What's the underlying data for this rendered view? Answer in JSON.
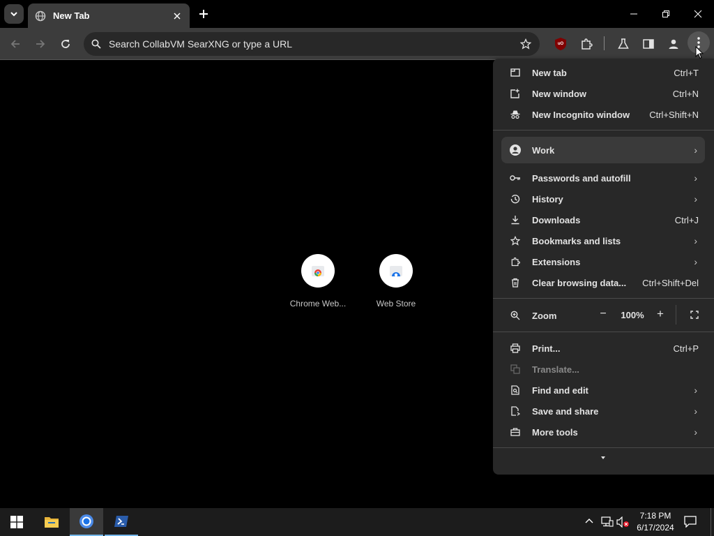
{
  "tab": {
    "title": "New Tab"
  },
  "omnibox": {
    "placeholder": "Search CollabVM SearXNG or type a URL"
  },
  "extensions": {
    "ublock_badge": "uO"
  },
  "shortcuts": [
    {
      "label": "Chrome Web..."
    },
    {
      "label": "Web Store"
    }
  ],
  "menu": {
    "new_tab": {
      "label": "New tab",
      "shortcut": "Ctrl+T"
    },
    "new_window": {
      "label": "New window",
      "shortcut": "Ctrl+N"
    },
    "new_incognito": {
      "label": "New Incognito window",
      "shortcut": "Ctrl+Shift+N"
    },
    "profile": {
      "label": "Work"
    },
    "passwords": {
      "label": "Passwords and autofill"
    },
    "history": {
      "label": "History"
    },
    "downloads": {
      "label": "Downloads",
      "shortcut": "Ctrl+J"
    },
    "bookmarks": {
      "label": "Bookmarks and lists"
    },
    "extensions": {
      "label": "Extensions"
    },
    "clear_data": {
      "label": "Clear browsing data...",
      "shortcut": "Ctrl+Shift+Del"
    },
    "zoom": {
      "label": "Zoom",
      "minus": "−",
      "value": "100%",
      "plus": "+"
    },
    "print": {
      "label": "Print...",
      "shortcut": "Ctrl+P"
    },
    "translate": {
      "label": "Translate..."
    },
    "find_edit": {
      "label": "Find and edit"
    },
    "save_share": {
      "label": "Save and share"
    },
    "more_tools": {
      "label": "More tools"
    }
  },
  "taskbar": {
    "time": "7:18 PM",
    "date": "6/17/2024"
  },
  "colors": {
    "menu_bg": "#282828",
    "toolbar_bg": "#3c3c3c",
    "taskbar_bg": "#1c1c1c",
    "accent_blue": "#1a73e8"
  }
}
